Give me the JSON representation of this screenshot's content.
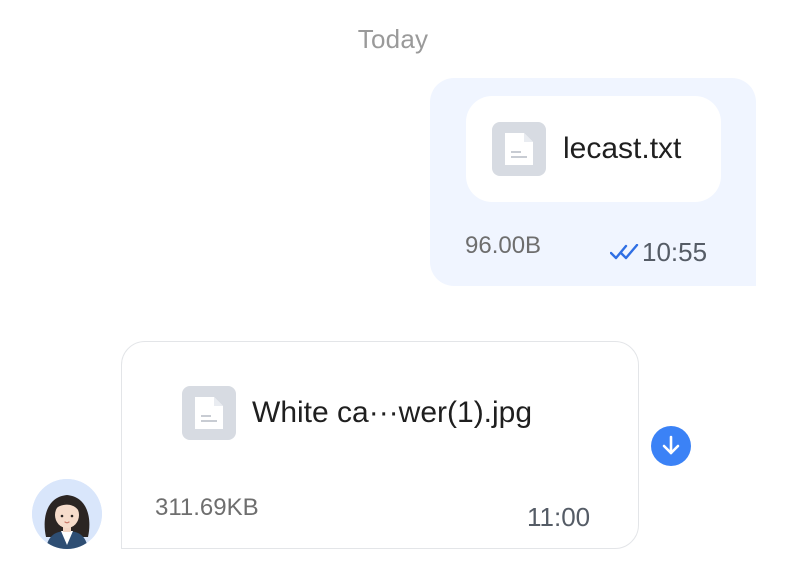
{
  "chat": {
    "date_divider": "Today",
    "messages": [
      {
        "direction": "outgoing",
        "file_name": "lecast.txt",
        "file_size": "96.00B",
        "time": "10:55",
        "status": "read",
        "file_icon": "document-icon",
        "status_icon": "double-check-icon"
      },
      {
        "direction": "incoming",
        "file_name": "White ca···wer(1).jpg",
        "file_size": "311.69KB",
        "time": "11:00",
        "file_icon": "document-icon",
        "action_icon": "download-icon",
        "sender_avatar": "avatar-woman"
      }
    ]
  },
  "colors": {
    "accent": "#3b82f6",
    "outgoing_bubble": "#f0f5ff",
    "read_check": "#2f6fe4"
  }
}
